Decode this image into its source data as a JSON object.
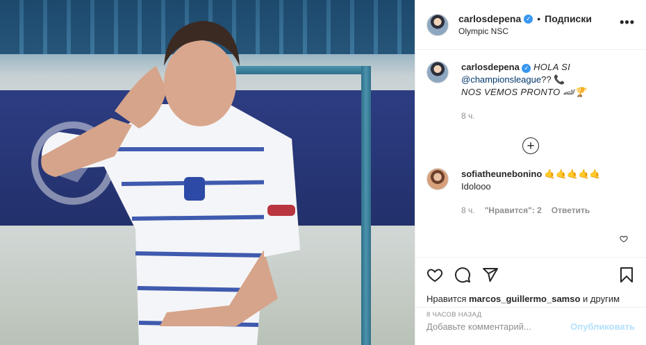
{
  "post": {
    "author": "carlosdepena",
    "follow_prefix": "•",
    "follow_label": "Подписки",
    "location": "Olympic NSC",
    "more_label": "•••",
    "verified_mark": "✓"
  },
  "caption": {
    "username": "carlosdepena",
    "line1": "HOLA SI",
    "mention": "@championsleague",
    "line2_suffix": "?? 📞",
    "line3": "NOS VEMOS PRONTO 🏎🏆",
    "time": "8 ч."
  },
  "load_more": {
    "label": "+"
  },
  "comment": {
    "username": "sofiatheunebonino",
    "badge": "🤙🤙🤙🤙🤙",
    "text": "Idolooo",
    "time": "8 ч.",
    "likes": "\"Нравится\": 2",
    "reply": "Ответить"
  },
  "actions": {
    "likes_prefix": "Нравится",
    "likes_user": "marcos_guillermo_samso",
    "likes_suffix": "и другим",
    "timestamp": "8 часов назад"
  },
  "compose": {
    "placeholder": "Добавьте комментарий...",
    "publish": "Опубликовать"
  },
  "colors": {
    "link": "#00376b",
    "publish_disabled": "#b2dffc",
    "muted": "#8e8e8e",
    "verified": "#3897f0"
  },
  "icons": [
    "heart-icon",
    "comment-icon",
    "share-icon",
    "bookmark-icon",
    "more-icon",
    "add-circle-icon",
    "verified-icon"
  ]
}
